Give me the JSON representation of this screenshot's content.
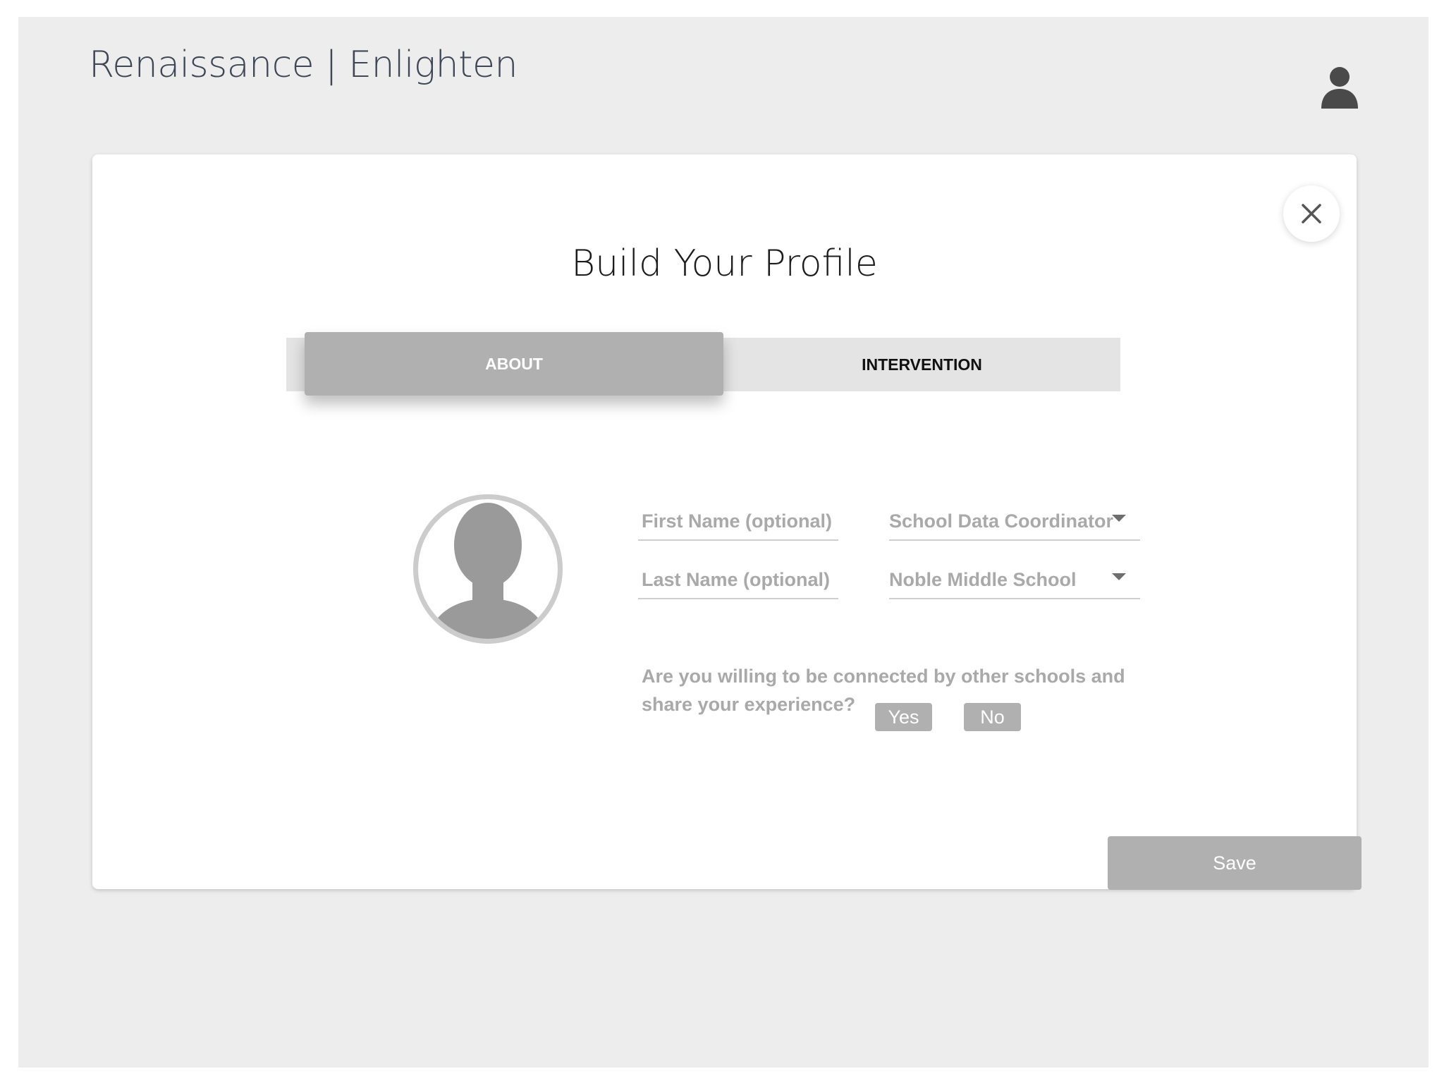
{
  "header": {
    "brand": "Renaissance | Enlighten",
    "user_icon": "user-icon"
  },
  "dialog": {
    "title": "Build Your Profile",
    "close_icon": "close-icon",
    "tabs": [
      {
        "label": "ABOUT",
        "active": true
      },
      {
        "label": "INTERVENTION",
        "active": false
      }
    ],
    "avatar_icon": "avatar-placeholder-icon",
    "fields": {
      "first_name": {
        "placeholder": "First Name (optional)",
        "value": ""
      },
      "last_name": {
        "placeholder": "Last Name (optional)",
        "value": ""
      },
      "role": {
        "selected": "School Data Coordinator"
      },
      "school": {
        "selected": "Noble Middle School"
      }
    },
    "question": "Are you willing to be connected by other schools and share your experience?",
    "options": {
      "yes": "Yes",
      "no": "No"
    },
    "save_label": "Save"
  },
  "colors": {
    "page_bg": "#ededed",
    "card_bg": "#ffffff",
    "button_gray": "#b0b0b0",
    "tab_track": "#e4e4e4",
    "muted_text": "#a9a9a9",
    "brand_text": "#3f4656"
  }
}
